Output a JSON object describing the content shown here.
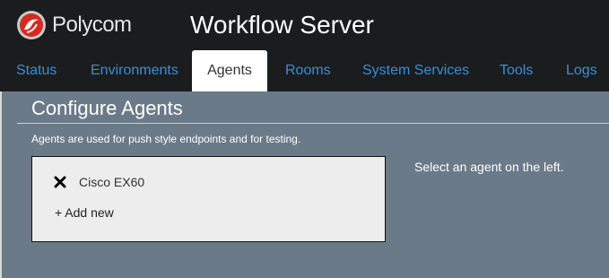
{
  "header": {
    "brand_name": "Polycom",
    "app_title": "Workflow Server",
    "logo_icon": "polycom-logo-icon"
  },
  "nav": {
    "tabs": [
      {
        "label": "Status"
      },
      {
        "label": "Environments"
      },
      {
        "label": "Agents",
        "active": true
      },
      {
        "label": "Rooms"
      },
      {
        "label": "System Services"
      },
      {
        "label": "Tools"
      },
      {
        "label": "Logs"
      }
    ]
  },
  "main": {
    "title": "Configure Agents",
    "subtitle": "Agents are used for push style endpoints and for testing.",
    "agents": [
      {
        "name": "Cisco EX60",
        "remove_icon": "close-icon"
      }
    ],
    "add_new_label": "+ Add new",
    "hint": "Select an agent on the left."
  },
  "colors": {
    "header_bg": "#1b1c1d",
    "tab_link": "#3b8ed8",
    "content_bg": "#6b7a88",
    "panel_bg": "#ededed"
  }
}
